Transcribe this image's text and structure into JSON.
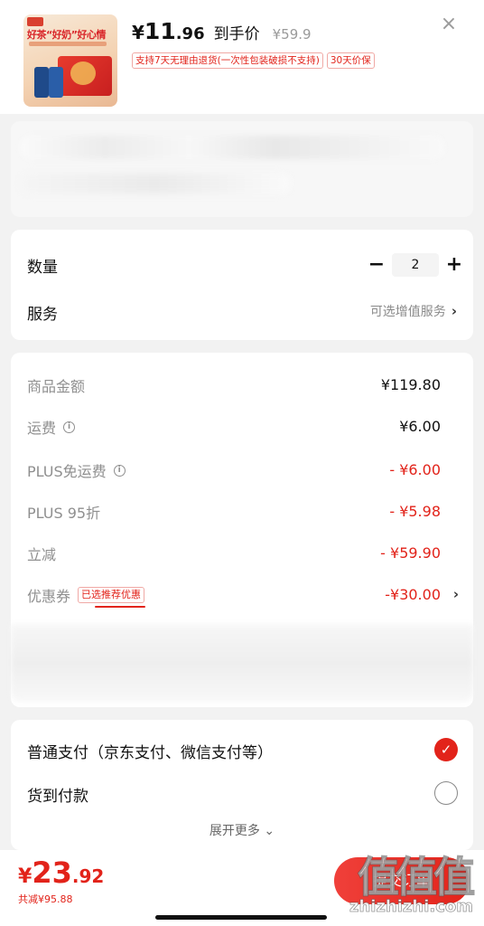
{
  "product": {
    "image_slogan": "好茶“好奶”好心情",
    "price_yen": "¥",
    "price_integer": "11",
    "price_decimal": ".96",
    "price_label": "到手价",
    "original_price": "¥59.9",
    "tags": [
      "支持7天无理由退货(一次性包装破损不支持)",
      "30天价保"
    ],
    "close_glyph": "×"
  },
  "quantity": {
    "label": "数量",
    "minus": "−",
    "value": "2",
    "plus": "+"
  },
  "service": {
    "label": "服务",
    "value": "可选增值服务",
    "chevron": "›"
  },
  "summary": {
    "rows": [
      {
        "label": "商品金额",
        "value": "¥119.80"
      },
      {
        "label": "运费",
        "value": "¥6.00"
      },
      {
        "label": "PLUS免运费",
        "value": "- ¥6.00"
      },
      {
        "label": "PLUS 95折",
        "value": "- ¥5.98"
      },
      {
        "label": "立减",
        "value": "- ¥59.90"
      },
      {
        "label": "优惠券",
        "tag": "已选推荐优惠",
        "value": "-¥30.00"
      }
    ],
    "info_glyph": "i",
    "chevron": "›"
  },
  "payment": {
    "options": [
      "普通支付（京东支付、微信支付等）",
      "货到付款"
    ],
    "check_glyph": "✓",
    "expand_label": "展开更多 ⌄"
  },
  "footer": {
    "total_yen": "¥",
    "total_integer": "23",
    "total_decimal": ".92",
    "saved": "共减¥95.88",
    "submit_label": "提交订单"
  },
  "watermark": {
    "zh": "值值值",
    "en": "zhizhizhi.com"
  },
  "colors": {
    "accent": "#e2231a",
    "muted": "#8f8f8f"
  }
}
